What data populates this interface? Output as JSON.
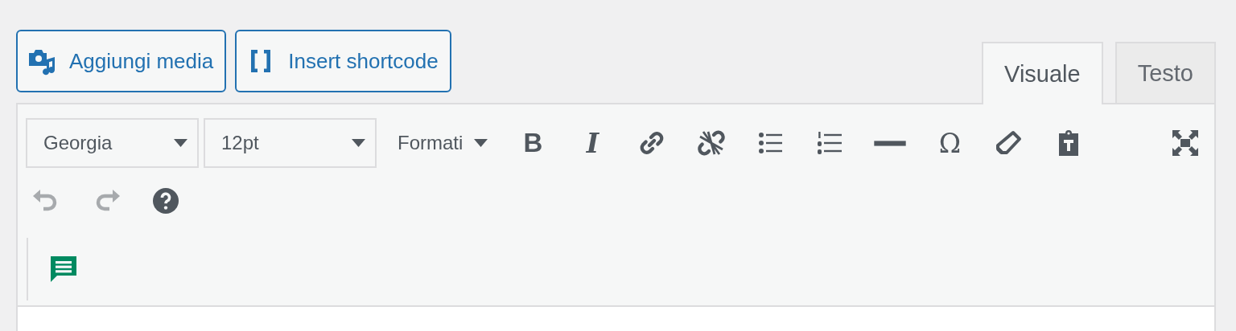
{
  "media_buttons": [
    {
      "label": "Aggiungi media",
      "kind": "media"
    },
    {
      "label": "Insert shortcode",
      "kind": "shortcode"
    }
  ],
  "tabs": [
    {
      "label": "Visuale",
      "selected": true
    },
    {
      "label": "Testo",
      "selected": false
    }
  ],
  "toolbar_rows": [
    {
      "items": [
        {
          "kind": "select",
          "value": "Georgia"
        },
        {
          "kind": "select",
          "value": "12pt"
        },
        {
          "kind": "menu",
          "label": "Formati"
        },
        {
          "kind": "bold",
          "glyph": "B",
          "disabled": false
        },
        {
          "kind": "italic",
          "glyph": "I",
          "disabled": false
        },
        {
          "kind": "link",
          "disabled": false
        },
        {
          "kind": "unlink",
          "disabled": false
        },
        {
          "kind": "bullets",
          "disabled": false
        },
        {
          "kind": "numbers",
          "disabled": false
        },
        {
          "kind": "hr",
          "disabled": false
        },
        {
          "kind": "charmap",
          "glyph": "Ω",
          "disabled": false
        },
        {
          "kind": "eraser",
          "disabled": false
        },
        {
          "kind": "paste",
          "disabled": false
        },
        {
          "kind": "fullscreen",
          "disabled": false
        }
      ]
    },
    {
      "items": [
        {
          "kind": "undo",
          "disabled": true
        },
        {
          "kind": "redo",
          "disabled": true
        },
        {
          "kind": "help",
          "disabled": false
        }
      ]
    },
    {
      "divider": true,
      "items": [
        {
          "kind": "comment",
          "disabled": false
        }
      ]
    }
  ]
}
